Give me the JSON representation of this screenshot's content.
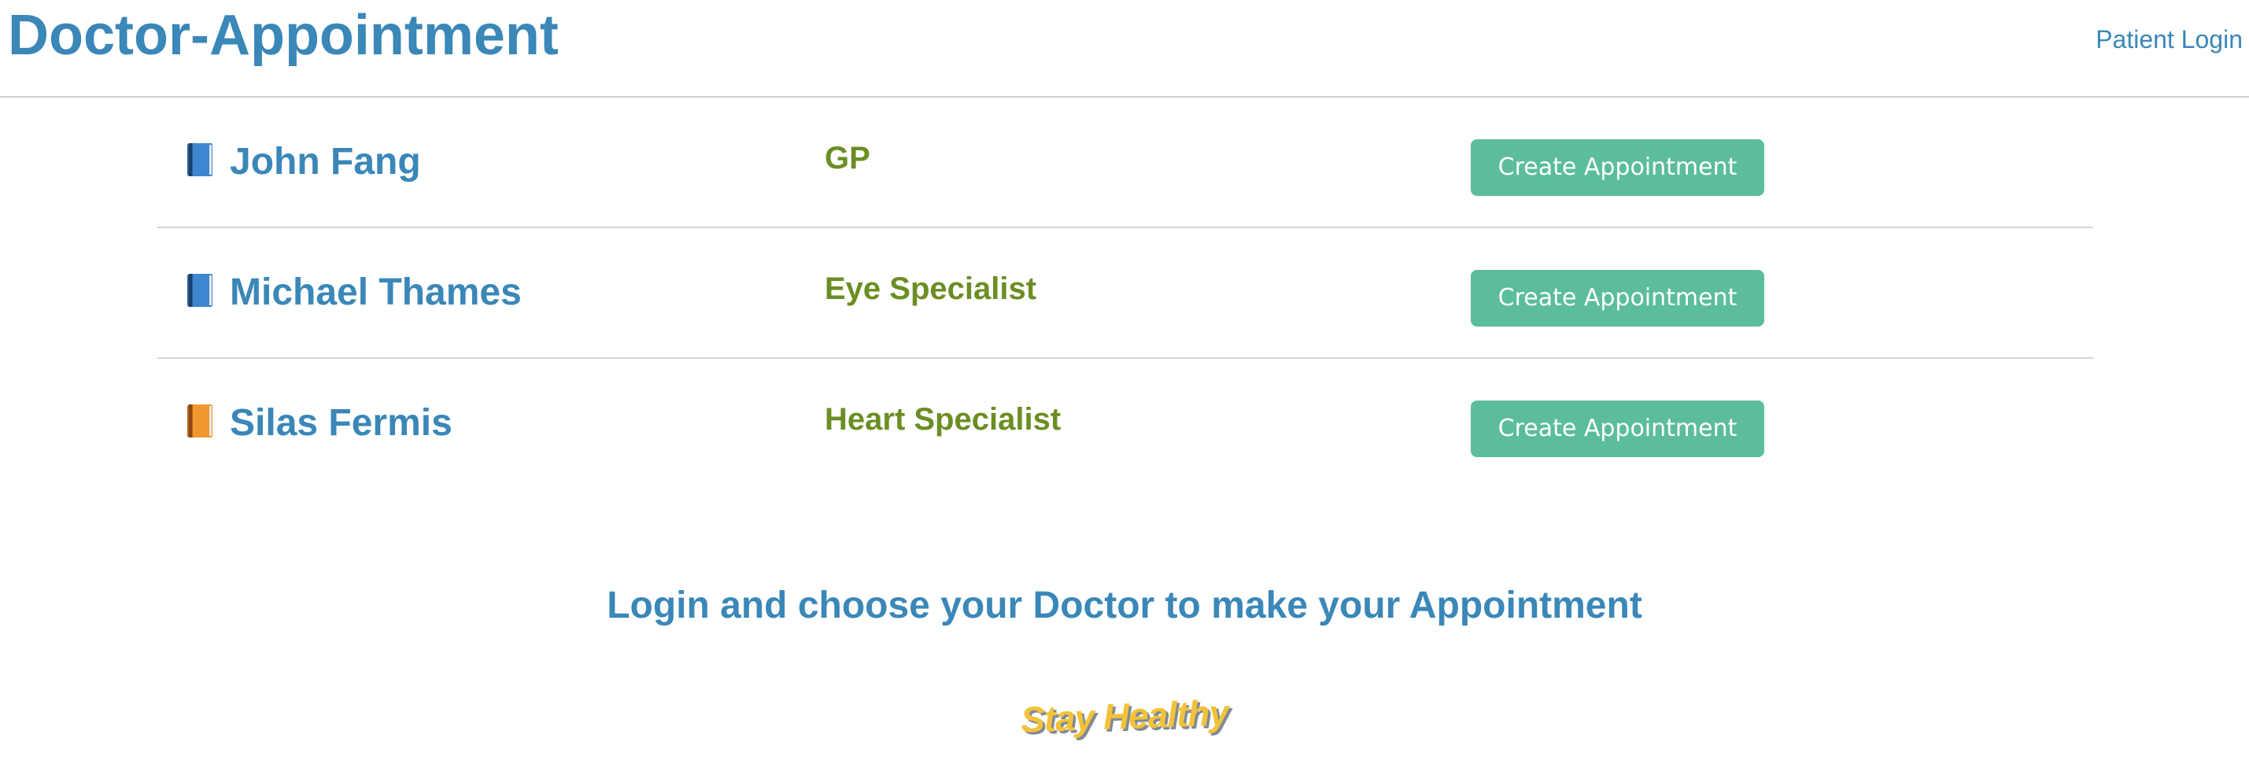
{
  "header": {
    "brand": "Doctor-Appointment",
    "login_link": "Patient Login"
  },
  "doctors": [
    {
      "name": "John Fang",
      "specialty": "GP",
      "button_label": "Create Appointment",
      "icon": "blue-book-icon",
      "icon_color": "#3a7cc4"
    },
    {
      "name": "Michael Thames",
      "specialty": "Eye Specialist",
      "button_label": "Create Appointment",
      "icon": "blue-book-icon",
      "icon_color": "#3a7cc4"
    },
    {
      "name": "Silas Fermis",
      "specialty": "Heart Specialist",
      "button_label": "Create Appointment",
      "icon": "orange-book-icon",
      "icon_color": "#e8912e"
    }
  ],
  "footer": {
    "cta": "Login and choose your Doctor to make your Appointment",
    "tagline": "Stay Healthy"
  },
  "colors": {
    "primary": "#3a87b8",
    "specialty": "#6b8e23",
    "button": "#5bbd9b",
    "tagline": "#f2c23a"
  }
}
